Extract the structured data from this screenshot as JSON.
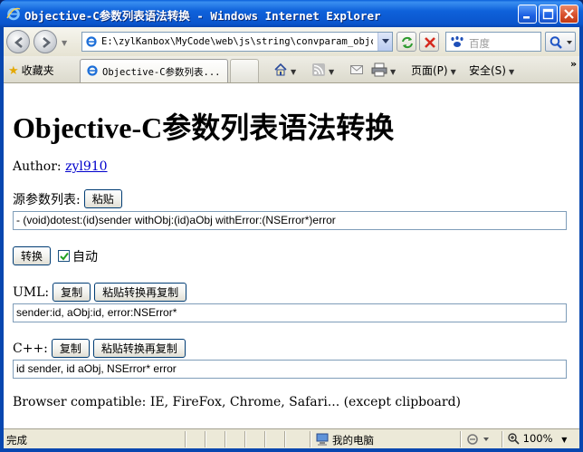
{
  "window": {
    "title": "Objective-C参数列表语法转换 - Windows Internet Explorer"
  },
  "toolbar": {
    "address": "E:\\zylKanbox\\MyCode\\web\\js\\string\\convparam_objc\\c",
    "search_placeholder": "百度",
    "favorites_label": "收藏夹",
    "tab_label": "Objective-C参数列表...",
    "page_menu": "页面(P)",
    "safety_menu": "安全(S)",
    "overflow": "»"
  },
  "page": {
    "heading": "Objective-C参数列表语法转换",
    "author_label": "Author:",
    "author_link": "zyl910",
    "source_label": "源参数列表:",
    "paste_button": "粘贴",
    "source_value": "- (void)dotest:(id)sender withObj:(id)aObj withError:(NSError*)error",
    "convert_button": "转换",
    "auto_label": "自动",
    "auto_checked": true,
    "uml_label": "UML:",
    "copy_button": "复制",
    "paste_convert_copy_button": "粘贴转换再复制",
    "uml_value": "sender:id, aObj:id, error:NSError*",
    "cpp_label": "C++:",
    "cpp_value": "id sender, id aObj, NSError* error",
    "compat_text": "Browser compatible: IE, FireFox, Chrome, Safari... (except clipboard)"
  },
  "status": {
    "done": "完成",
    "zone": "我的电脑",
    "zoom": "100%"
  },
  "colors": {
    "titlebar": "#0a54cc",
    "link": "#0000cc",
    "chrome": "#ece9d8"
  }
}
